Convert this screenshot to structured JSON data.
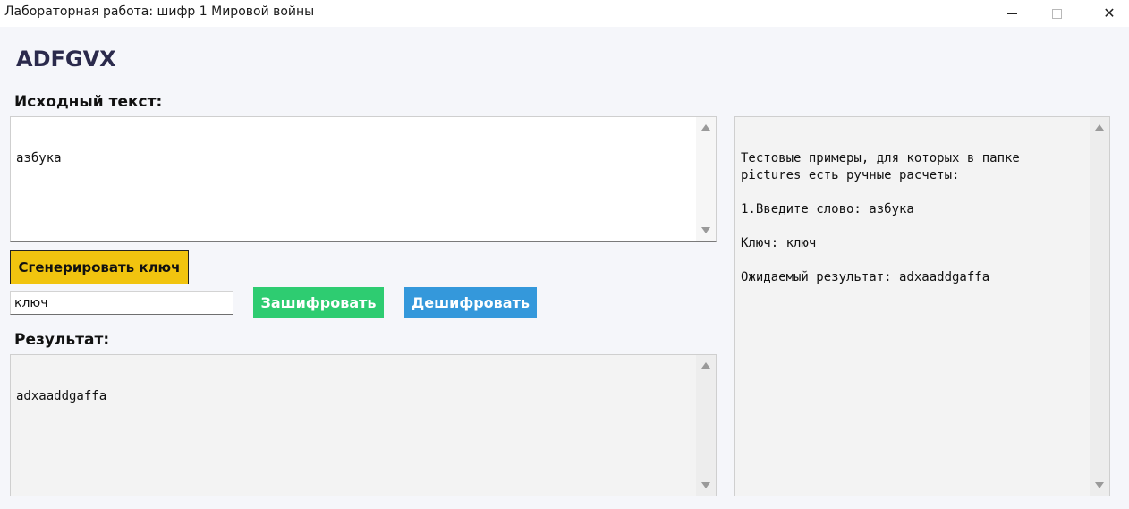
{
  "window": {
    "title": "Лабораторная работа: шифр 1 Мировой войны",
    "minimize_glyph": "",
    "close_glyph": "✕"
  },
  "app": {
    "title": "ADFGVX"
  },
  "source": {
    "label": "Исходный текст:",
    "value": "азбука"
  },
  "controls": {
    "generate_label": "Сгенерировать ключ",
    "key_value": "ключ",
    "encrypt_label": "Зашифровать",
    "decrypt_label": "Дешифровать"
  },
  "result": {
    "label": "Результат:",
    "value": "adxaaddgaffa"
  },
  "info": {
    "text": "Тестовые примеры, для которых в папке\npictures есть ручные расчеты:\n\n1.Введите слово: азбука\n\nКлюч: ключ\n\nОжидаемый результат: adxaaddgaffa"
  },
  "colors": {
    "generate_button": "#f1c40f",
    "encrypt_button": "#2ecc71",
    "decrypt_button": "#3498db",
    "title_text": "#2b2a4c"
  },
  "icons": {
    "minimize": "minimize-icon",
    "maximize": "maximize-icon",
    "close": "close-icon",
    "scroll_up": "scroll-up-icon",
    "scroll_down": "scroll-down-icon"
  }
}
